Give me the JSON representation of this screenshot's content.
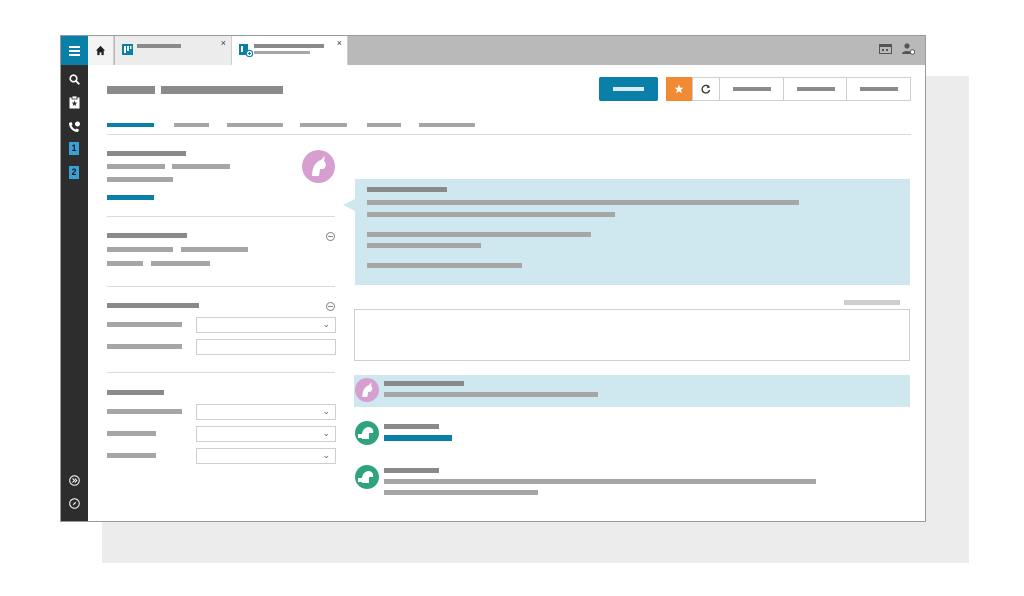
{
  "window": {
    "title": ""
  },
  "tabs": [
    {
      "label": "",
      "subtitle": "",
      "active": false,
      "close": "×"
    },
    {
      "label": "",
      "subtitle": "",
      "active": true,
      "close": "×"
    }
  ],
  "sidebar": {
    "items": [
      {
        "icon": "search-icon"
      },
      {
        "icon": "clipboard-star-icon"
      },
      {
        "icon": "phone-icon"
      },
      {
        "icon": "screen-1-icon",
        "label": "1"
      },
      {
        "icon": "screen-2-icon",
        "label": "2"
      },
      {
        "icon": "expand-icon"
      },
      {
        "icon": "compass-icon"
      }
    ]
  },
  "toolbar": {
    "primary_label": "",
    "star_icon": "star-icon",
    "refresh_icon": "refresh-icon",
    "buttons": [
      "",
      "",
      ""
    ]
  },
  "colors": {
    "brand": "#0a7fa8",
    "accent": "#f08a34",
    "highlight": "#cfe8f0",
    "sidebar": "#2d2d2d"
  }
}
